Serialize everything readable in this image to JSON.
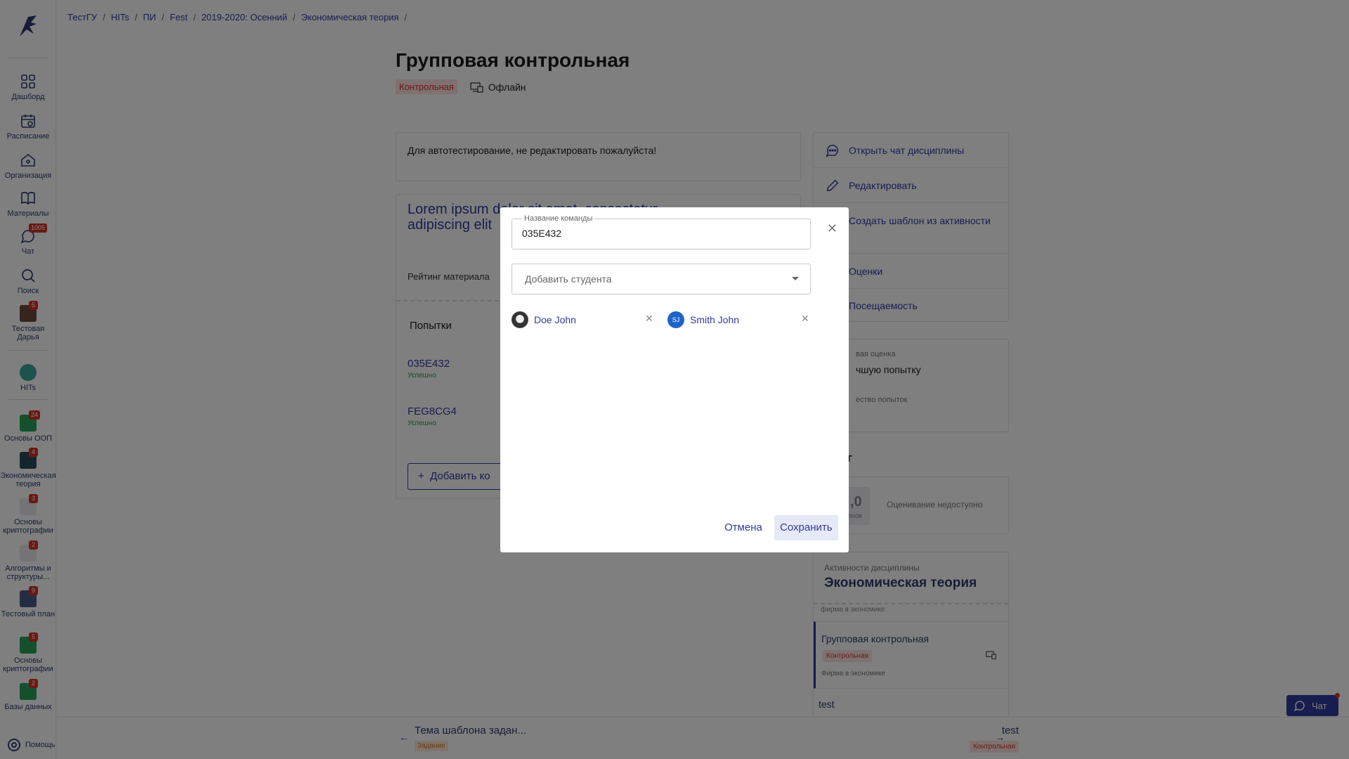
{
  "breadcrumb": [
    "ТестГУ",
    "HITs",
    "ПИ",
    "Fest",
    "2019-2020: Осенний",
    "Экономическая теория"
  ],
  "sidebar": {
    "items": [
      {
        "label": "Дашборд"
      },
      {
        "label": "Расписание"
      },
      {
        "label": "Организация"
      },
      {
        "label": "Материалы"
      },
      {
        "label": "Чат",
        "badge": "1005"
      },
      {
        "label": "Поиск"
      },
      {
        "label": "Тестовая Дарья",
        "badge": "5"
      },
      {
        "label": "HITs"
      },
      {
        "label": "Основы ООП",
        "badge": "24"
      },
      {
        "label": "Экономическая теория",
        "badge": "4"
      },
      {
        "label": "Основы криптографии",
        "badge": "3"
      },
      {
        "label": "Алгоритмы и структуры...",
        "badge": "2"
      },
      {
        "label": "Тестовый план",
        "badge": "9"
      },
      {
        "label": "Основы криптографии",
        "badge": "5"
      },
      {
        "label": "Базы данных",
        "badge": "2"
      }
    ],
    "help": "Помощь"
  },
  "page": {
    "title": "Групповая контрольная",
    "tag": "Контрольная",
    "mode": "Офлайн",
    "note": "Для автотестирование, не редактировать пожалуйста!",
    "material_title": "Lorem ipsum dolor sit amet, consectetur adipiscing elit",
    "rating_label": "Рейтинг материала",
    "attempts_label": "Попытки",
    "attempts": [
      {
        "name": "035E432",
        "status": "Успешно"
      },
      {
        "name": "FEG8CG4",
        "status": "Успешно"
      }
    ],
    "add_button": "Добавить ко"
  },
  "actions": [
    "Открыть чат дисциплины",
    "Редактировать",
    "Создать шаблон из активности",
    "Оценки",
    "Посещаемость"
  ],
  "grade": {
    "label1": "вая оценка",
    "value1": "чшую попытку",
    "label2": "ество попыток"
  },
  "rating": {
    "heading": "инг",
    "value": ",0",
    "value_label": "енок",
    "status": "Оценивание недоступно"
  },
  "discipline": {
    "caption": "Активности дисциплины",
    "name": "Экономическая теория",
    "faded": "фирма в экономике",
    "activity_title": "Групповая контрольная",
    "activity_tag": "Контрольная",
    "activity_sub": "Фирма в экономике",
    "next_item": "test"
  },
  "bottom": {
    "prev_title": "Тема шаблона задан...",
    "prev_tag": "Задание",
    "next_title": "test",
    "next_tag": "Контрольная"
  },
  "chat_button": "Чат",
  "modal": {
    "name_label": "Название команды",
    "name_value": "035E432",
    "add_student_placeholder": "Добавить студента",
    "members": [
      {
        "name": "Doe John",
        "initials": ""
      },
      {
        "name": "Smith John",
        "initials": "SJ"
      }
    ],
    "cancel": "Отмена",
    "save": "Сохранить"
  },
  "colors": {
    "accent": "#2f3a9e",
    "danger": "#d93025",
    "success": "#1f9d4a"
  }
}
